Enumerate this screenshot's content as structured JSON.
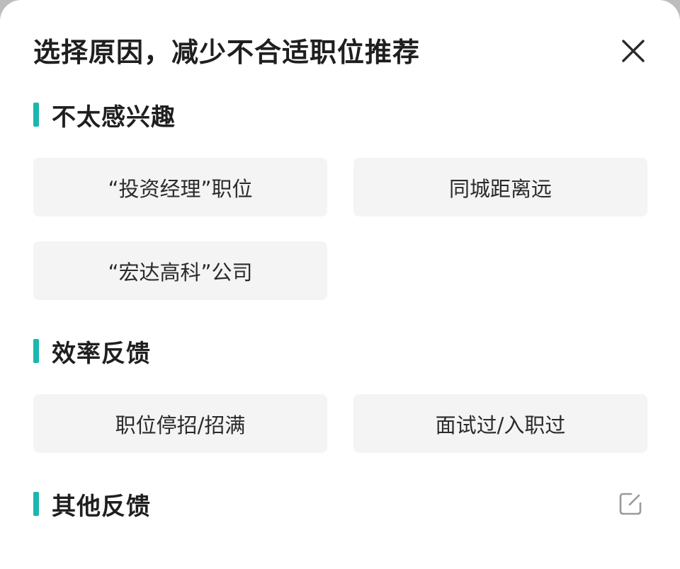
{
  "header": {
    "title": "选择原因，减少不合适职位推荐"
  },
  "sections": [
    {
      "title": "不太感兴趣",
      "chips": [
        "“投资经理”职位",
        "同城距离远",
        "“宏达高科”公司"
      ]
    },
    {
      "title": "效率反馈",
      "chips": [
        "职位停招/招满",
        "面试过/入职过"
      ]
    },
    {
      "title": "其他反馈",
      "chips": []
    }
  ],
  "colors": {
    "accent": "#1bb7ae",
    "chip_bg": "#f4f4f4",
    "text": "#1f1f1f"
  },
  "icons": {
    "close": "close-icon",
    "edit": "edit-icon"
  }
}
